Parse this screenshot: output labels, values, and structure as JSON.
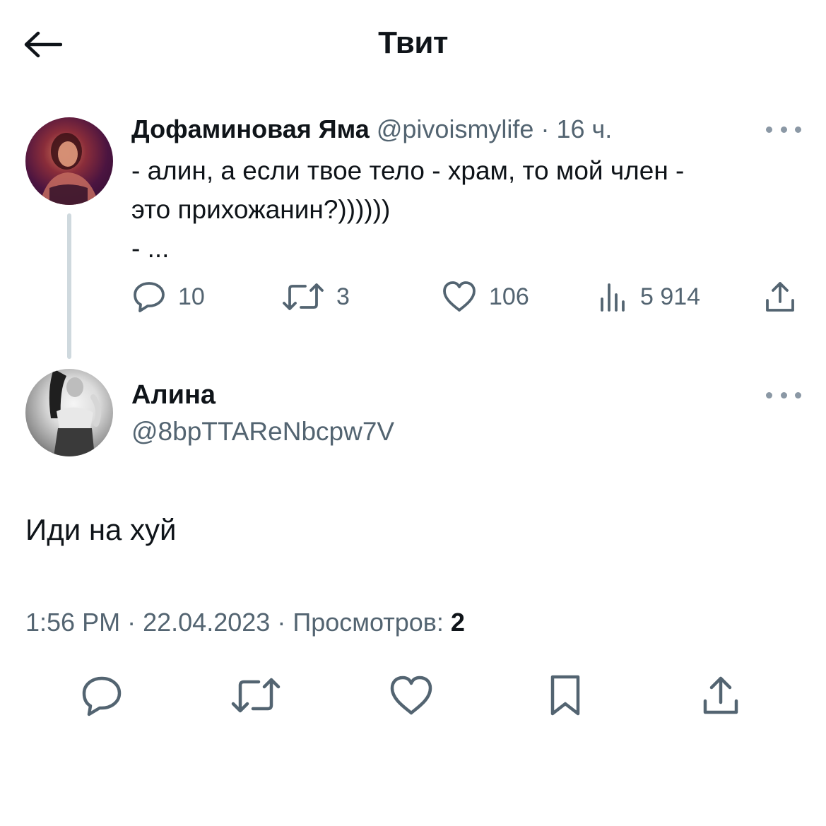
{
  "header": {
    "title": "Твит"
  },
  "parent_tweet": {
    "author_name": "Дофаминовая Яма",
    "handle": "@pivoismylife",
    "separator": "·",
    "time": "16 ч.",
    "text_lines": [
      "- алин, а если твое тело - храм, то мой член -",
      "это прихожанин?))))))",
      "- ..."
    ],
    "replies": "10",
    "retweets": "3",
    "likes": "106",
    "views": "5 914"
  },
  "reply_tweet": {
    "author_name": "Алина",
    "handle": "@8bpTTAReNbcpw7V",
    "text": "Иди на хуй",
    "time": "1:56 PM",
    "date": "22.04.2023",
    "separator": "·",
    "views_label": "Просмотров:",
    "views_count": "2"
  },
  "icons": {
    "back": "arrow-left-icon",
    "more": "ellipsis-icon",
    "reply": "speech-bubble-icon",
    "retweet": "retweet-icon",
    "like": "heart-icon",
    "views": "bar-chart-icon",
    "share": "share-icon",
    "bookmark": "bookmark-icon"
  },
  "colors": {
    "text": "#0f1419",
    "muted": "#536471",
    "thread_line": "#cfd9de"
  }
}
